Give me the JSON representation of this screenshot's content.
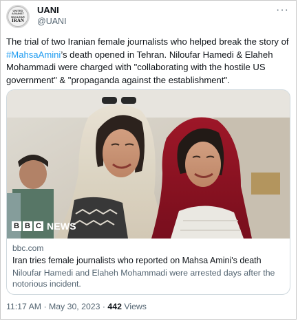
{
  "tweet": {
    "author": {
      "display_name": "UANI",
      "handle": "@UANI",
      "avatar_lines": [
        "UNITED",
        "AGAINST",
        "NUCLEAR",
        "IRAN"
      ]
    },
    "more_icon": "more-horizontal-icon",
    "text_before": "The trial of two Iranian female journalists who helped break the story of ",
    "hashtag": "#MahsaAmini",
    "text_after": "’s death opened in Tehran. Niloufar Hamedi & Elaheh Mohammadi were charged with \"collaborating with the hostile US government\" & \"propaganda against the establishment\".",
    "card": {
      "image_logo_blocks": [
        "B",
        "B",
        "C"
      ],
      "image_logo_word": "NEWS",
      "domain": "bbc.com",
      "title": "Iran tries female journalists who reported on Mahsa Amini's death",
      "description": "Niloufar Hamedi and Elaheh Mohammadi were arrested days after the notorious incident."
    },
    "footer": {
      "timestamp": "11:17 AM · May 30, 2023 · ",
      "views_count": "442",
      "views_label": " Views"
    }
  },
  "colors": {
    "link": "#1d9bf0",
    "text": "#0f1419",
    "secondary": "#536471",
    "border": "#cfd9de"
  }
}
